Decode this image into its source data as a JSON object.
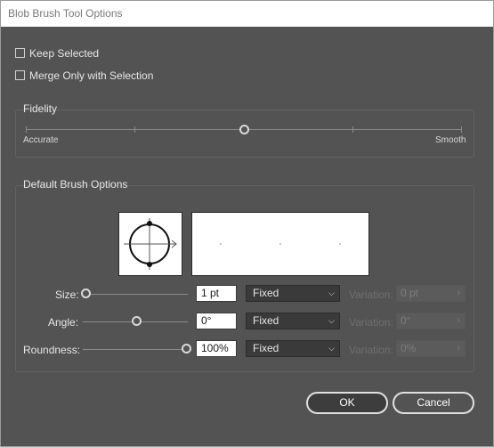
{
  "window": {
    "title": "Blob Brush Tool Options"
  },
  "options": {
    "keep_selected": "Keep Selected",
    "merge_only": "Merge Only with Selection"
  },
  "fidelity": {
    "title": "Fidelity",
    "left_label": "Accurate",
    "right_label": "Smooth",
    "value_fraction": 0.5
  },
  "brush": {
    "title": "Default Brush Options",
    "rows": [
      {
        "label": "Size:",
        "value": "1 pt",
        "mode": "Fixed",
        "variation_label": "Variation:",
        "variation_value": "0 pt",
        "slider_fraction": 0.0
      },
      {
        "label": "Angle:",
        "value": "0°",
        "mode": "Fixed",
        "variation_label": "Variation:",
        "variation_value": "0°",
        "slider_fraction": 0.5
      },
      {
        "label": "Roundness:",
        "value": "100%",
        "mode": "Fixed",
        "variation_label": "Variation:",
        "variation_value": "0%",
        "slider_fraction": 1.0
      }
    ]
  },
  "buttons": {
    "ok": "OK",
    "cancel": "Cancel"
  },
  "icons": {
    "dropdown": "chevron-down-icon",
    "variation": "chevron-right-icon"
  }
}
